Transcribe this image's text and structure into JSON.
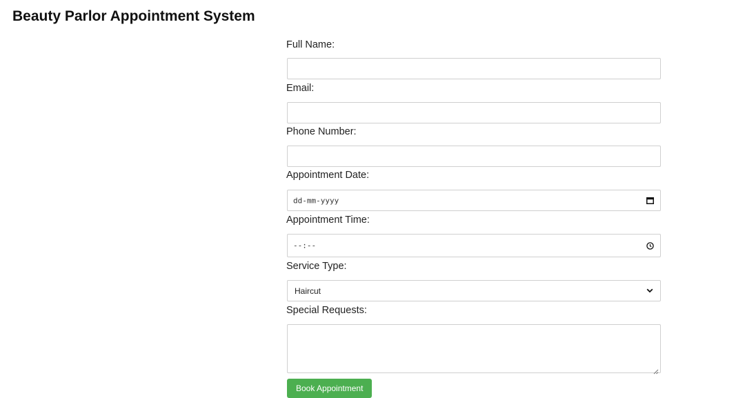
{
  "page": {
    "title": "Beauty Parlor Appointment System"
  },
  "form": {
    "full_name": {
      "label": "Full Name:",
      "value": ""
    },
    "email": {
      "label": "Email:",
      "value": ""
    },
    "phone": {
      "label": "Phone Number:",
      "value": ""
    },
    "date": {
      "label": "Appointment Date:",
      "value": "dd-mm-yyyy",
      "icon": "calendar-icon"
    },
    "time": {
      "label": "Appointment Time:",
      "value": "--:--",
      "icon": "clock-icon"
    },
    "service": {
      "label": "Service Type:",
      "selected": "Haircut",
      "icon": "chevron-down-icon"
    },
    "requests": {
      "label": "Special Requests:",
      "value": ""
    },
    "submit_label": "Book Appointment"
  },
  "colors": {
    "button_bg": "#4caf50",
    "button_text": "#ffffff",
    "border": "#cfcfcf"
  }
}
